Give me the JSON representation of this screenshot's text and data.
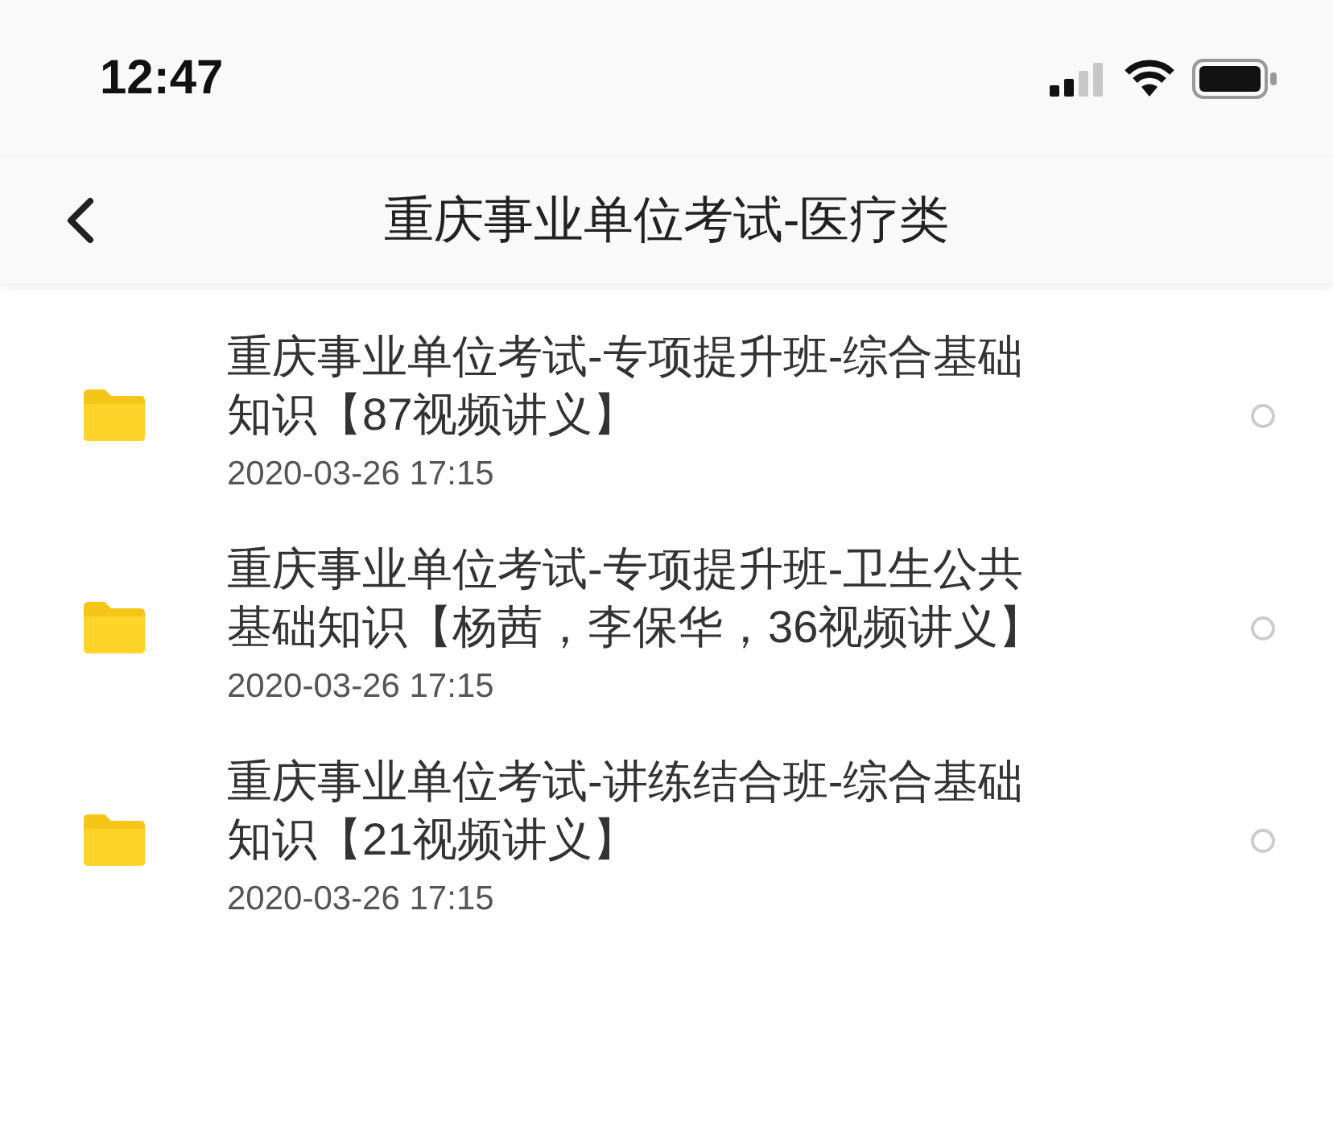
{
  "status_bar": {
    "time": "12:47"
  },
  "nav": {
    "title": "重庆事业单位考试-医疗类"
  },
  "files": [
    {
      "kind": "folder",
      "name": "重庆事业单位考试-专项提升班-综合基础知识【87视频讲义】",
      "date": "2020-03-26 17:15",
      "selected": false
    },
    {
      "kind": "folder",
      "name": "重庆事业单位考试-专项提升班-卫生公共基础知识【杨茜，李保华，36视频讲义】",
      "date": "2020-03-26 17:15",
      "selected": false
    },
    {
      "kind": "folder",
      "name": "重庆事业单位考试-讲练结合班-综合基础知识【21视频讲义】",
      "date": "2020-03-26 17:15",
      "selected": false
    }
  ]
}
